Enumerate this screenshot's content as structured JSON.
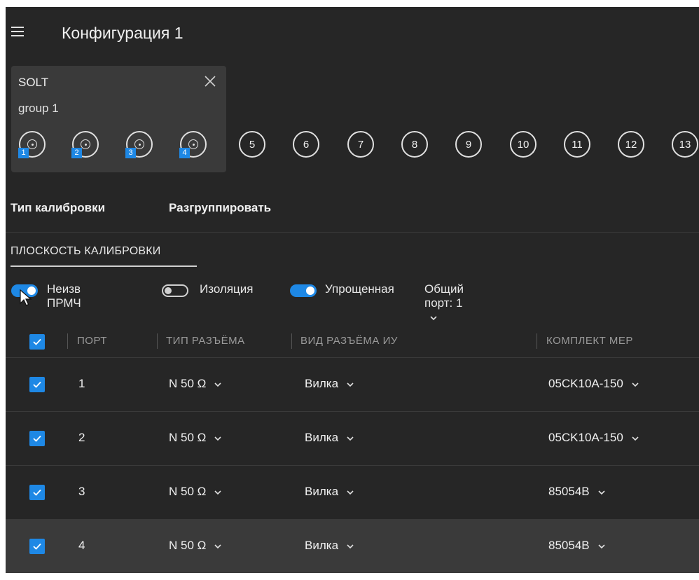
{
  "header": {
    "title": "Конфигурация 1",
    "menu_icon": "hamburger-menu-icon"
  },
  "group": {
    "name": "SOLT",
    "subtitle": "group 1",
    "close_icon": "close-icon",
    "ports": [
      {
        "badge": "1"
      },
      {
        "badge": "2"
      },
      {
        "badge": "3"
      },
      {
        "badge": "4"
      }
    ]
  },
  "free_ports": [
    "5",
    "6",
    "7",
    "8",
    "9",
    "10",
    "11",
    "12",
    "13"
  ],
  "toolbar": {
    "calib_type": "Тип калибровки",
    "ungroup": "Разгруппировать"
  },
  "tab": {
    "label": "ПЛОСКОСТЬ КАЛИБРОВКИ"
  },
  "options": {
    "unknown_thru": {
      "label": "Неизв ПРМЧ",
      "on": true
    },
    "isolation": {
      "label": "Изоляция",
      "on": false
    },
    "simplified": {
      "label": "Упрощенная",
      "on": true
    },
    "common_port": {
      "label": "Общий порт: 1"
    }
  },
  "table": {
    "headers": {
      "port": "ПОРТ",
      "connector_type": "ТИП РАЗЪЁМА",
      "connector_gender": "ВИД РАЗЪЁМА ИУ",
      "cal_kit": "КОМПЛЕКТ МЕР"
    },
    "rows": [
      {
        "port": "1",
        "type": "N 50 Ω",
        "gender": "Вилка",
        "kit": "05CK10A-150",
        "checked": true
      },
      {
        "port": "2",
        "type": "N 50 Ω",
        "gender": "Вилка",
        "kit": "05CK10A-150",
        "checked": true
      },
      {
        "port": "3",
        "type": "N 50 Ω",
        "gender": "Вилка",
        "kit": "85054B",
        "checked": true
      },
      {
        "port": "4",
        "type": "N 50 Ω",
        "gender": "Вилка",
        "kit": "85054B",
        "checked": true
      }
    ]
  },
  "colors": {
    "accent": "#1e88e5",
    "panel": "#262626",
    "card": "#3a3a3a"
  }
}
